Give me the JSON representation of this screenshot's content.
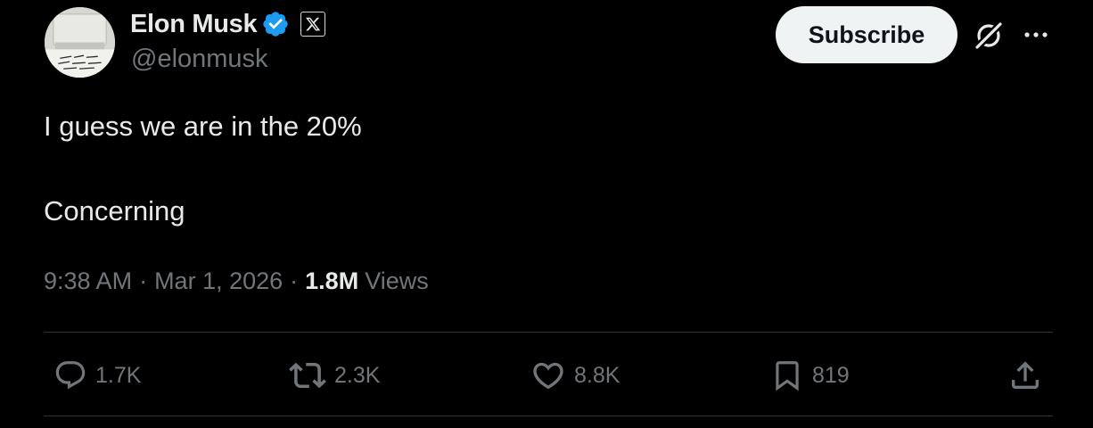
{
  "author": {
    "name": "Elon Musk",
    "handle": "@elonmusk",
    "verified_icon": "verified-badge-icon",
    "affiliate_icon": "x-logo-icon",
    "avatar_icon": "avatar-image"
  },
  "header": {
    "subscribe_label": "Subscribe",
    "grok_icon": "grok-icon",
    "more_icon": "more-options-icon"
  },
  "tweet": {
    "lines": [
      "I guess we are in the 20%",
      "Concerning"
    ]
  },
  "meta": {
    "time": "9:38 AM",
    "separator": "·",
    "date": "Mar 1, 2026",
    "views_count": "1.8M",
    "views_label": "Views"
  },
  "actions": {
    "reply": {
      "icon": "reply-icon",
      "count": "1.7K"
    },
    "repost": {
      "icon": "repost-icon",
      "count": "2.3K"
    },
    "like": {
      "icon": "like-icon",
      "count": "8.8K"
    },
    "bookmark": {
      "icon": "bookmark-icon",
      "count": "819"
    },
    "share": {
      "icon": "share-icon"
    }
  },
  "colors": {
    "background": "#000000",
    "text_primary": "#e7e9ea",
    "text_secondary": "#71767b",
    "verified_blue": "#1d9bf0",
    "button_bg": "#eff3f4",
    "button_text": "#0f1419",
    "divider": "#2f3336"
  }
}
